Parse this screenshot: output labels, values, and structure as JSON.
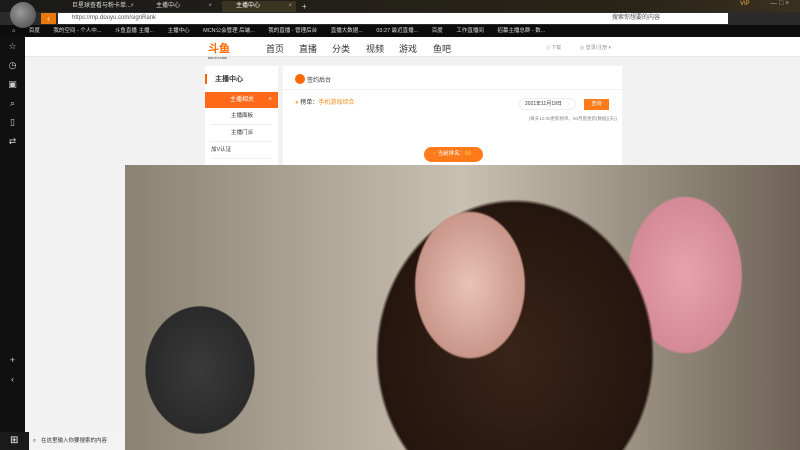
{
  "browser": {
    "tabs": [
      {
        "label": "巨星球查看与粉卡单..."
      },
      {
        "label": "主播中心"
      },
      {
        "label": "主播中心"
      }
    ],
    "url": "https://mp.douyu.com/signRank",
    "search_placeholder": "搜索你想要的内容",
    "vip": "VIP",
    "bookmarks": [
      "百度",
      "我的空间 - 个人中...",
      "斗鱼直播 主播...",
      "主播中心",
      "MCN公会管理 后端...",
      "我的直播 - 管理后台",
      "直播大数据...",
      "03:27 最近直播...",
      "百度",
      "工作直播间",
      "招募主播总群 - 数..."
    ]
  },
  "site": {
    "brand": "斗鱼",
    "brand_sub": "DOUYU.COM",
    "nav": [
      "首页",
      "直播",
      "分类",
      "视频",
      "游戏",
      "鱼吧"
    ],
    "download": "下载",
    "login": "登录/注册"
  },
  "left_menu": {
    "title": "主播中心",
    "section": "主播相关",
    "items": [
      "主播面板",
      "主播门派",
      "加V认证"
    ]
  },
  "panel": {
    "title": "签约后台",
    "rank_label": "榜单：",
    "rank_value": "手机游戏综合",
    "date": "2021年11月19日",
    "query_button": "查询",
    "note": "(每天12:00更新榜单，50月底更新(数据)(天))",
    "current_rank_label": "当前排名：",
    "current_rank_value": "50"
  },
  "taskbar": {
    "search_placeholder": "在这里输入你要搜索的内容"
  },
  "colors": {
    "accent": "#ff6a1a"
  }
}
